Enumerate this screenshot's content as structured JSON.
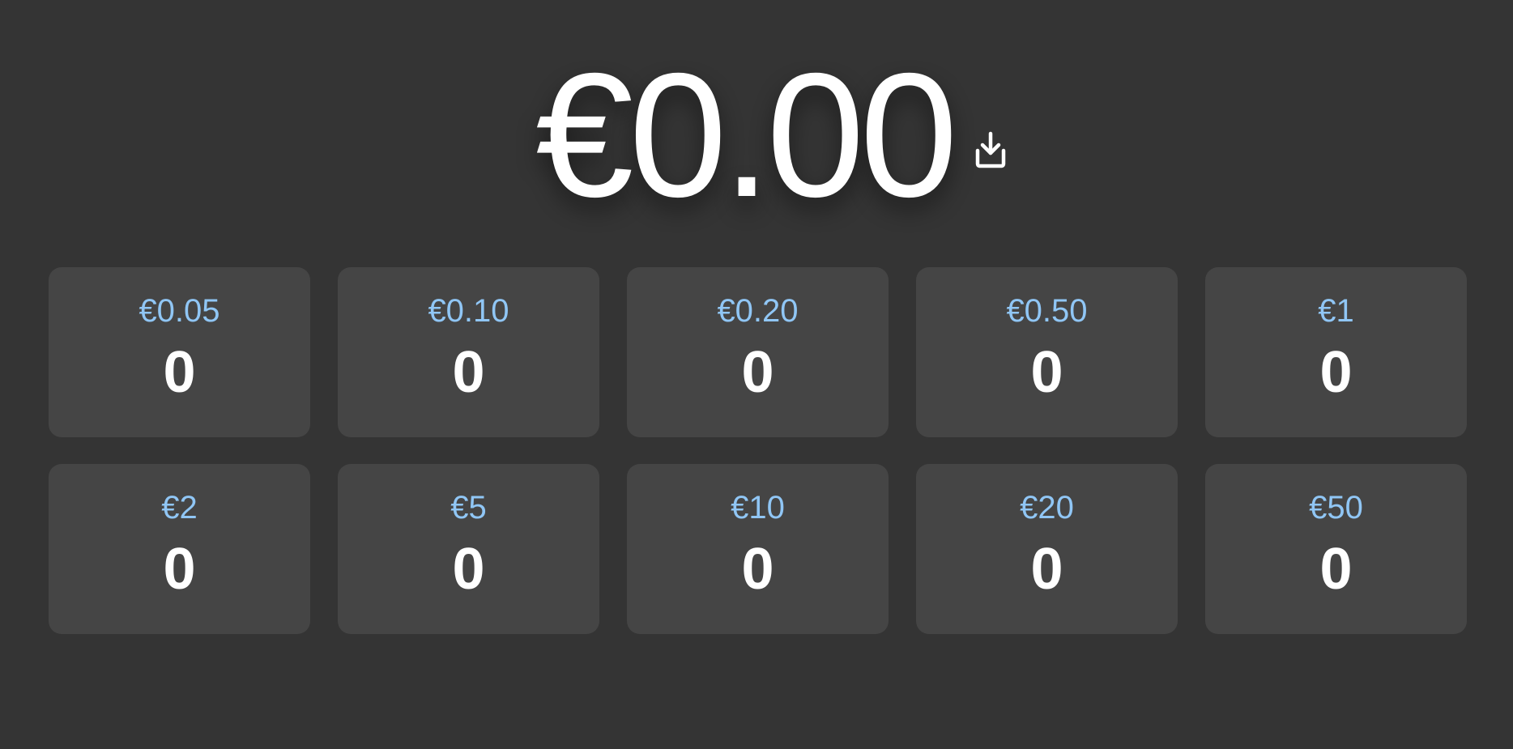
{
  "total": "€0.00",
  "download_icon": "download-icon",
  "colors": {
    "background": "#343434",
    "tile": "#454545",
    "denomination": "#90c6f5",
    "text": "#ffffff"
  },
  "denominations": [
    {
      "label": "€0.05",
      "count": "0"
    },
    {
      "label": "€0.10",
      "count": "0"
    },
    {
      "label": "€0.20",
      "count": "0"
    },
    {
      "label": "€0.50",
      "count": "0"
    },
    {
      "label": "€1",
      "count": "0"
    },
    {
      "label": "€2",
      "count": "0"
    },
    {
      "label": "€5",
      "count": "0"
    },
    {
      "label": "€10",
      "count": "0"
    },
    {
      "label": "€20",
      "count": "0"
    },
    {
      "label": "€50",
      "count": "0"
    }
  ]
}
